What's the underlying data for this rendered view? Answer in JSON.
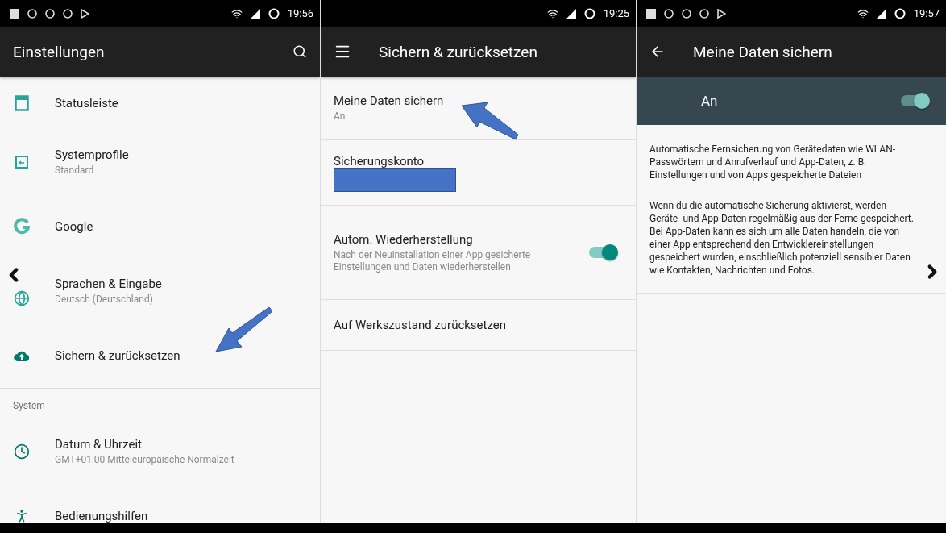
{
  "screens": [
    {
      "status_bar": {
        "time": "19:56",
        "notifications": true
      },
      "toolbar": {
        "title": "Einstellungen"
      },
      "items": [
        {
          "kind": "setting",
          "title": "Statusleiste"
        },
        {
          "kind": "setting",
          "title": "Systemprofile",
          "subtitle": "Standard"
        },
        {
          "kind": "setting",
          "title": "Google"
        },
        {
          "kind": "setting",
          "title": "Sprachen & Eingabe",
          "subtitle": "Deutsch (Deutschland)"
        },
        {
          "kind": "setting",
          "title": "Sichern & zurücksetzen"
        },
        {
          "kind": "header",
          "title": "System"
        },
        {
          "kind": "setting",
          "title": "Datum & Uhrzeit",
          "subtitle": "GMT+01:00 Mitteleuropäische Normalzeit"
        },
        {
          "kind": "setting",
          "title": "Bedienungshilfen"
        }
      ]
    },
    {
      "status_bar": {
        "time": "19:25",
        "notifications": false
      },
      "toolbar": {
        "title": "Sichern & zurücksetzen"
      },
      "items": [
        {
          "kind": "option",
          "title": "Meine Daten sichern",
          "subtitle": "An"
        },
        {
          "kind": "redacted",
          "title": "Sicherungskonto"
        },
        {
          "kind": "toggle",
          "title": "Autom. Wiederherstellung",
          "subtitle": "Nach der Neuinstallation einer App gesicherte Einstellungen und Daten wiederherstellen",
          "on": true
        },
        {
          "kind": "option",
          "title": "Auf Werkszustand zurücksetzen"
        }
      ]
    },
    {
      "status_bar": {
        "time": "19:57",
        "notifications": true
      },
      "toolbar": {
        "title": "Meine Daten sichern"
      },
      "items": [
        {
          "kind": "switch_bar",
          "title": "An",
          "on": true
        },
        {
          "kind": "paragraph",
          "title": "Automatische Fernsicherung von Gerätedaten wie WLAN-Passwörtern und Anrufverlauf und App-Daten, z. B. Einstellungen und von Apps gespeicherte Dateien"
        },
        {
          "kind": "paragraph",
          "title": "Wenn du die automatische Sicherung aktivierst, werden Geräte- und App-Daten regelmäßig aus der Ferne gespeichert. Bei App-Daten kann es sich um alle Daten handeln, die von einer App entsprechend den Entwicklereinstellungen gespeichert wurden, einschließlich potenziell sensibler Daten wie Kontakten, Nachrichten und Fotos."
        }
      ]
    }
  ]
}
